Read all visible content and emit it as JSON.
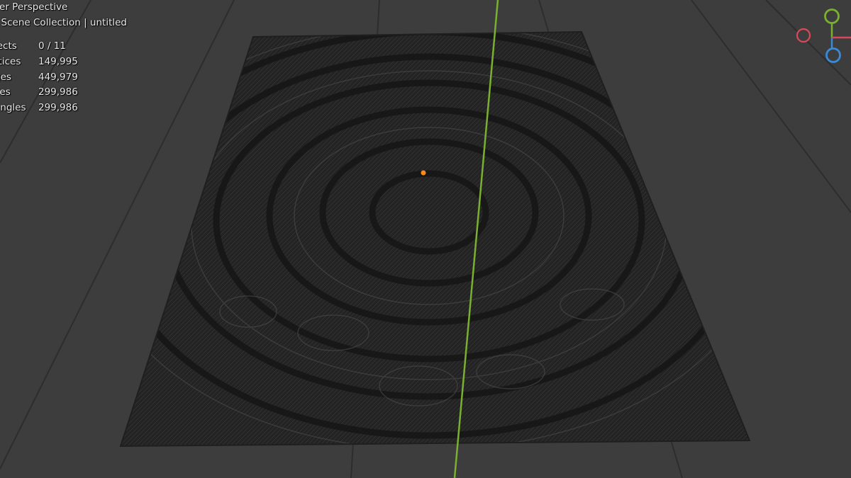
{
  "viewport": {
    "view_name": "ser Perspective",
    "collection_line": ") Scene Collection | untitled",
    "stats": [
      {
        "label": "jects",
        "value": "0 / 11"
      },
      {
        "label": "rtices",
        "value": "149,995"
      },
      {
        "label": "ges",
        "value": "449,979"
      },
      {
        "label": "ces",
        "value": "299,986"
      },
      {
        "label": "angles",
        "value": "299,986"
      }
    ]
  },
  "colors": {
    "background": "#3d3d3d",
    "grid": "#2b2b2b",
    "mesh": "#262626",
    "y_axis_line": "#7ab030",
    "origin": "#ff8a1a",
    "gizmo_x": "#d84a5a",
    "gizmo_y": "#7ab030",
    "gizmo_z": "#3a8ad8"
  },
  "gizmo": {
    "icons": [
      "axis-x-icon",
      "axis-y-icon",
      "axis-z-icon"
    ]
  }
}
